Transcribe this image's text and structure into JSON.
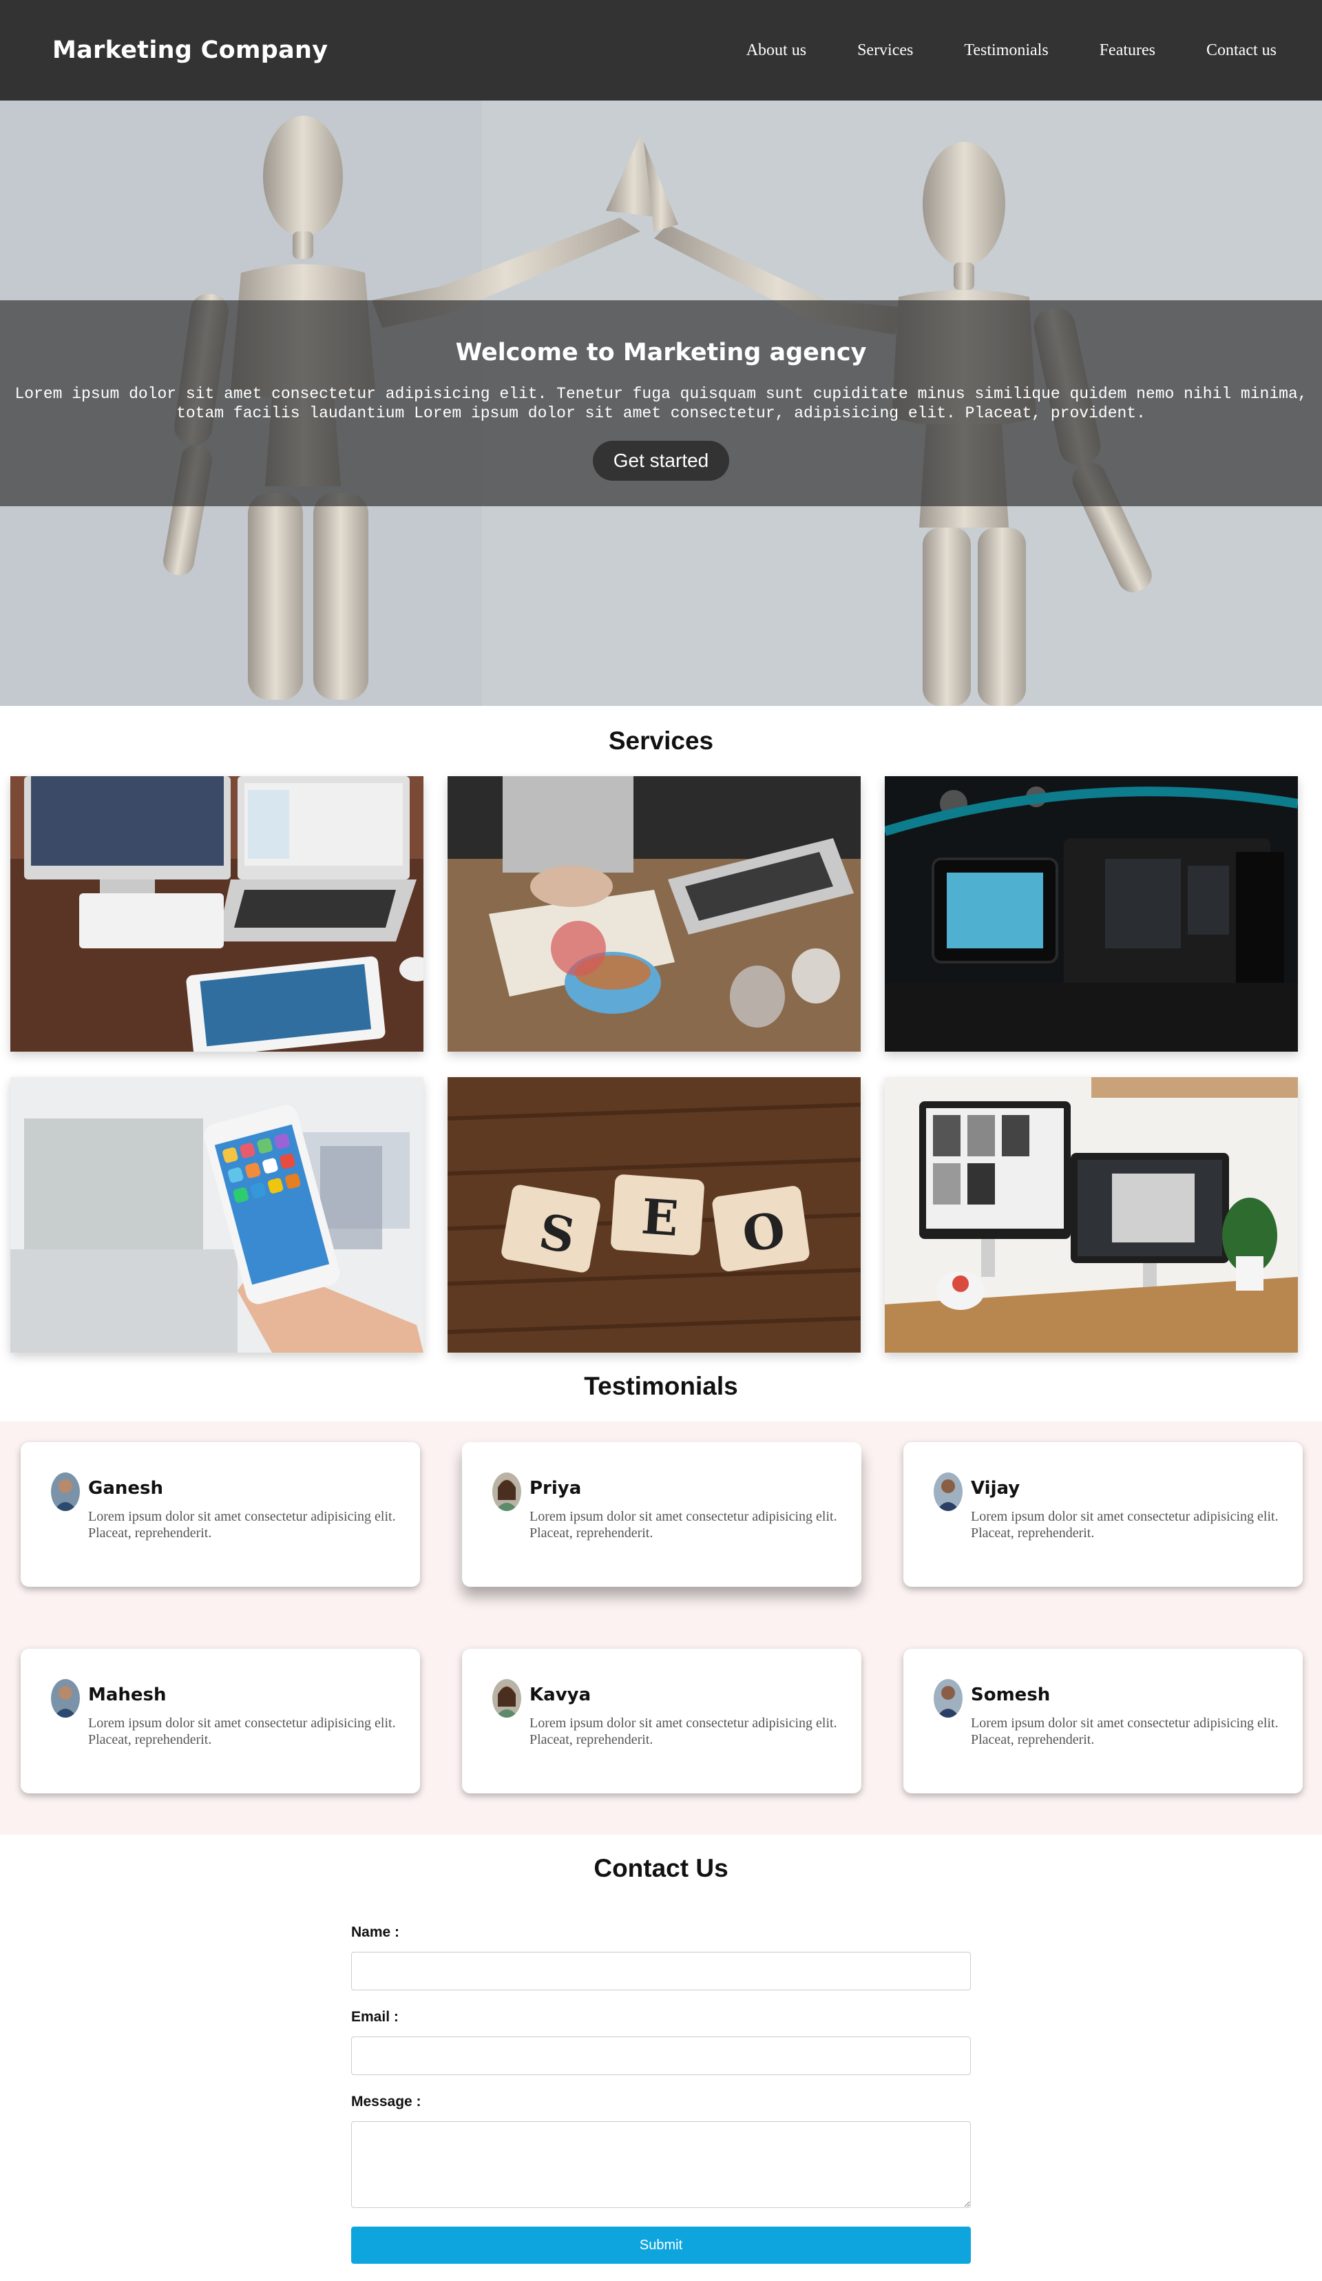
{
  "navbar": {
    "brand": "Marketing Company",
    "links": [
      "About us",
      "Services",
      "Testimonials",
      "Features",
      "Contact us"
    ]
  },
  "hero": {
    "title": "Welcome to Marketing agency",
    "text": "Lorem ipsum dolor sit amet consectetur adipisicing elit. Tenetur fuga quisquam sunt cupiditate minus similique quidem nemo nihil minima, totam facilis laudantium Lorem ipsum dolor sit amet consectetur, adipisicing elit. Placeat, provident.",
    "button": "Get started"
  },
  "services": {
    "title": "Services"
  },
  "testimonials": {
    "title": "Testimonials",
    "items": [
      {
        "name": "Ganesh",
        "text": "Lorem ipsum dolor sit amet consectetur adipisicing elit. Placeat, reprehenderit."
      },
      {
        "name": "Priya",
        "text": "Lorem ipsum dolor sit amet consectetur adipisicing elit. Placeat, reprehenderit."
      },
      {
        "name": "Vijay",
        "text": "Lorem ipsum dolor sit amet consectetur adipisicing elit. Placeat, reprehenderit."
      },
      {
        "name": "Mahesh",
        "text": "Lorem ipsum dolor sit amet consectetur adipisicing elit. Placeat, reprehenderit."
      },
      {
        "name": "Kavya",
        "text": "Lorem ipsum dolor sit amet consectetur adipisicing elit. Placeat, reprehenderit."
      },
      {
        "name": "Somesh",
        "text": "Lorem ipsum dolor sit amet consectetur adipisicing elit. Placeat, reprehenderit."
      }
    ]
  },
  "contact": {
    "title": "Contact Us",
    "name_label": "Name :",
    "email_label": "Email :",
    "message_label": "Message :",
    "submit": "Submit"
  },
  "colors": {
    "navbar": "#333333",
    "accent": "#0ea5df",
    "testimonials_bg": "#fbf2f1"
  }
}
